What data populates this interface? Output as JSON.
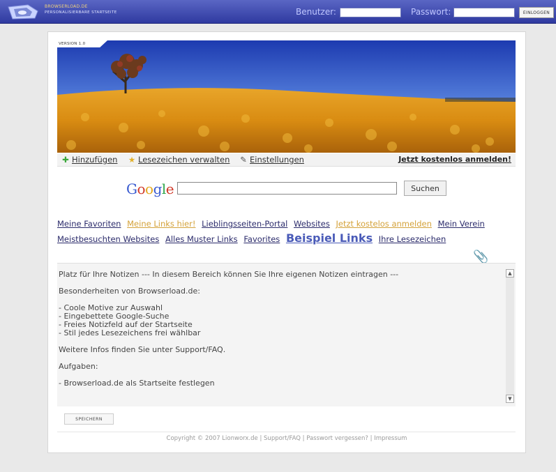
{
  "topbar": {
    "logo_line1": "BROWSERLOAD.DE",
    "logo_line2": "PERSONALISIERBARE STARTSEITE",
    "user_label": "Benutzer:",
    "password_label": "Passwort:",
    "login_button": "EINLOGGEN"
  },
  "banner": {
    "version": "VERSION 1.0"
  },
  "toolbar": {
    "add": "Hinzufügen",
    "manage": "Lesezeichen verwalten",
    "settings": "Einstellungen",
    "register": "Jetzt kostenlos anmelden!"
  },
  "search": {
    "logo": "Google",
    "button": "Suchen",
    "value": ""
  },
  "links": {
    "row1": [
      "Meine Favoriten",
      "Meine Links hier!",
      "Lieblingsseiten-Portal",
      "Websites",
      "Jetzt kostelos anmelden",
      "Mein Verein"
    ],
    "row2": [
      "Meistbesuchten Websites",
      "Alles Muster Links",
      "Favorites",
      "Beispiel Links",
      "Ihre Lesezeichen"
    ]
  },
  "notes": {
    "text": "Platz für Ihre Notizen --- In diesem Bereich können Sie Ihre eigenen Notizen eintragen ---\n\nBesonderheiten von Browserload.de:\n\n- Coole Motive zur Auswahl\n- Eingebettete Google-Suche\n- Freies Notizfeld auf der Startseite\n- Stil jedes Lesezeichens frei wählbar\n\nWeitere Infos finden Sie unter Support/FAQ.\n\nAufgaben:\n\n- Browserload.de als Startseite festlegen",
    "save_button": "SPEICHERN"
  },
  "footer": {
    "text": "Copyright © 2007 Lionworx.de | Support/FAQ | Passwort vergessen? | Impressum"
  }
}
